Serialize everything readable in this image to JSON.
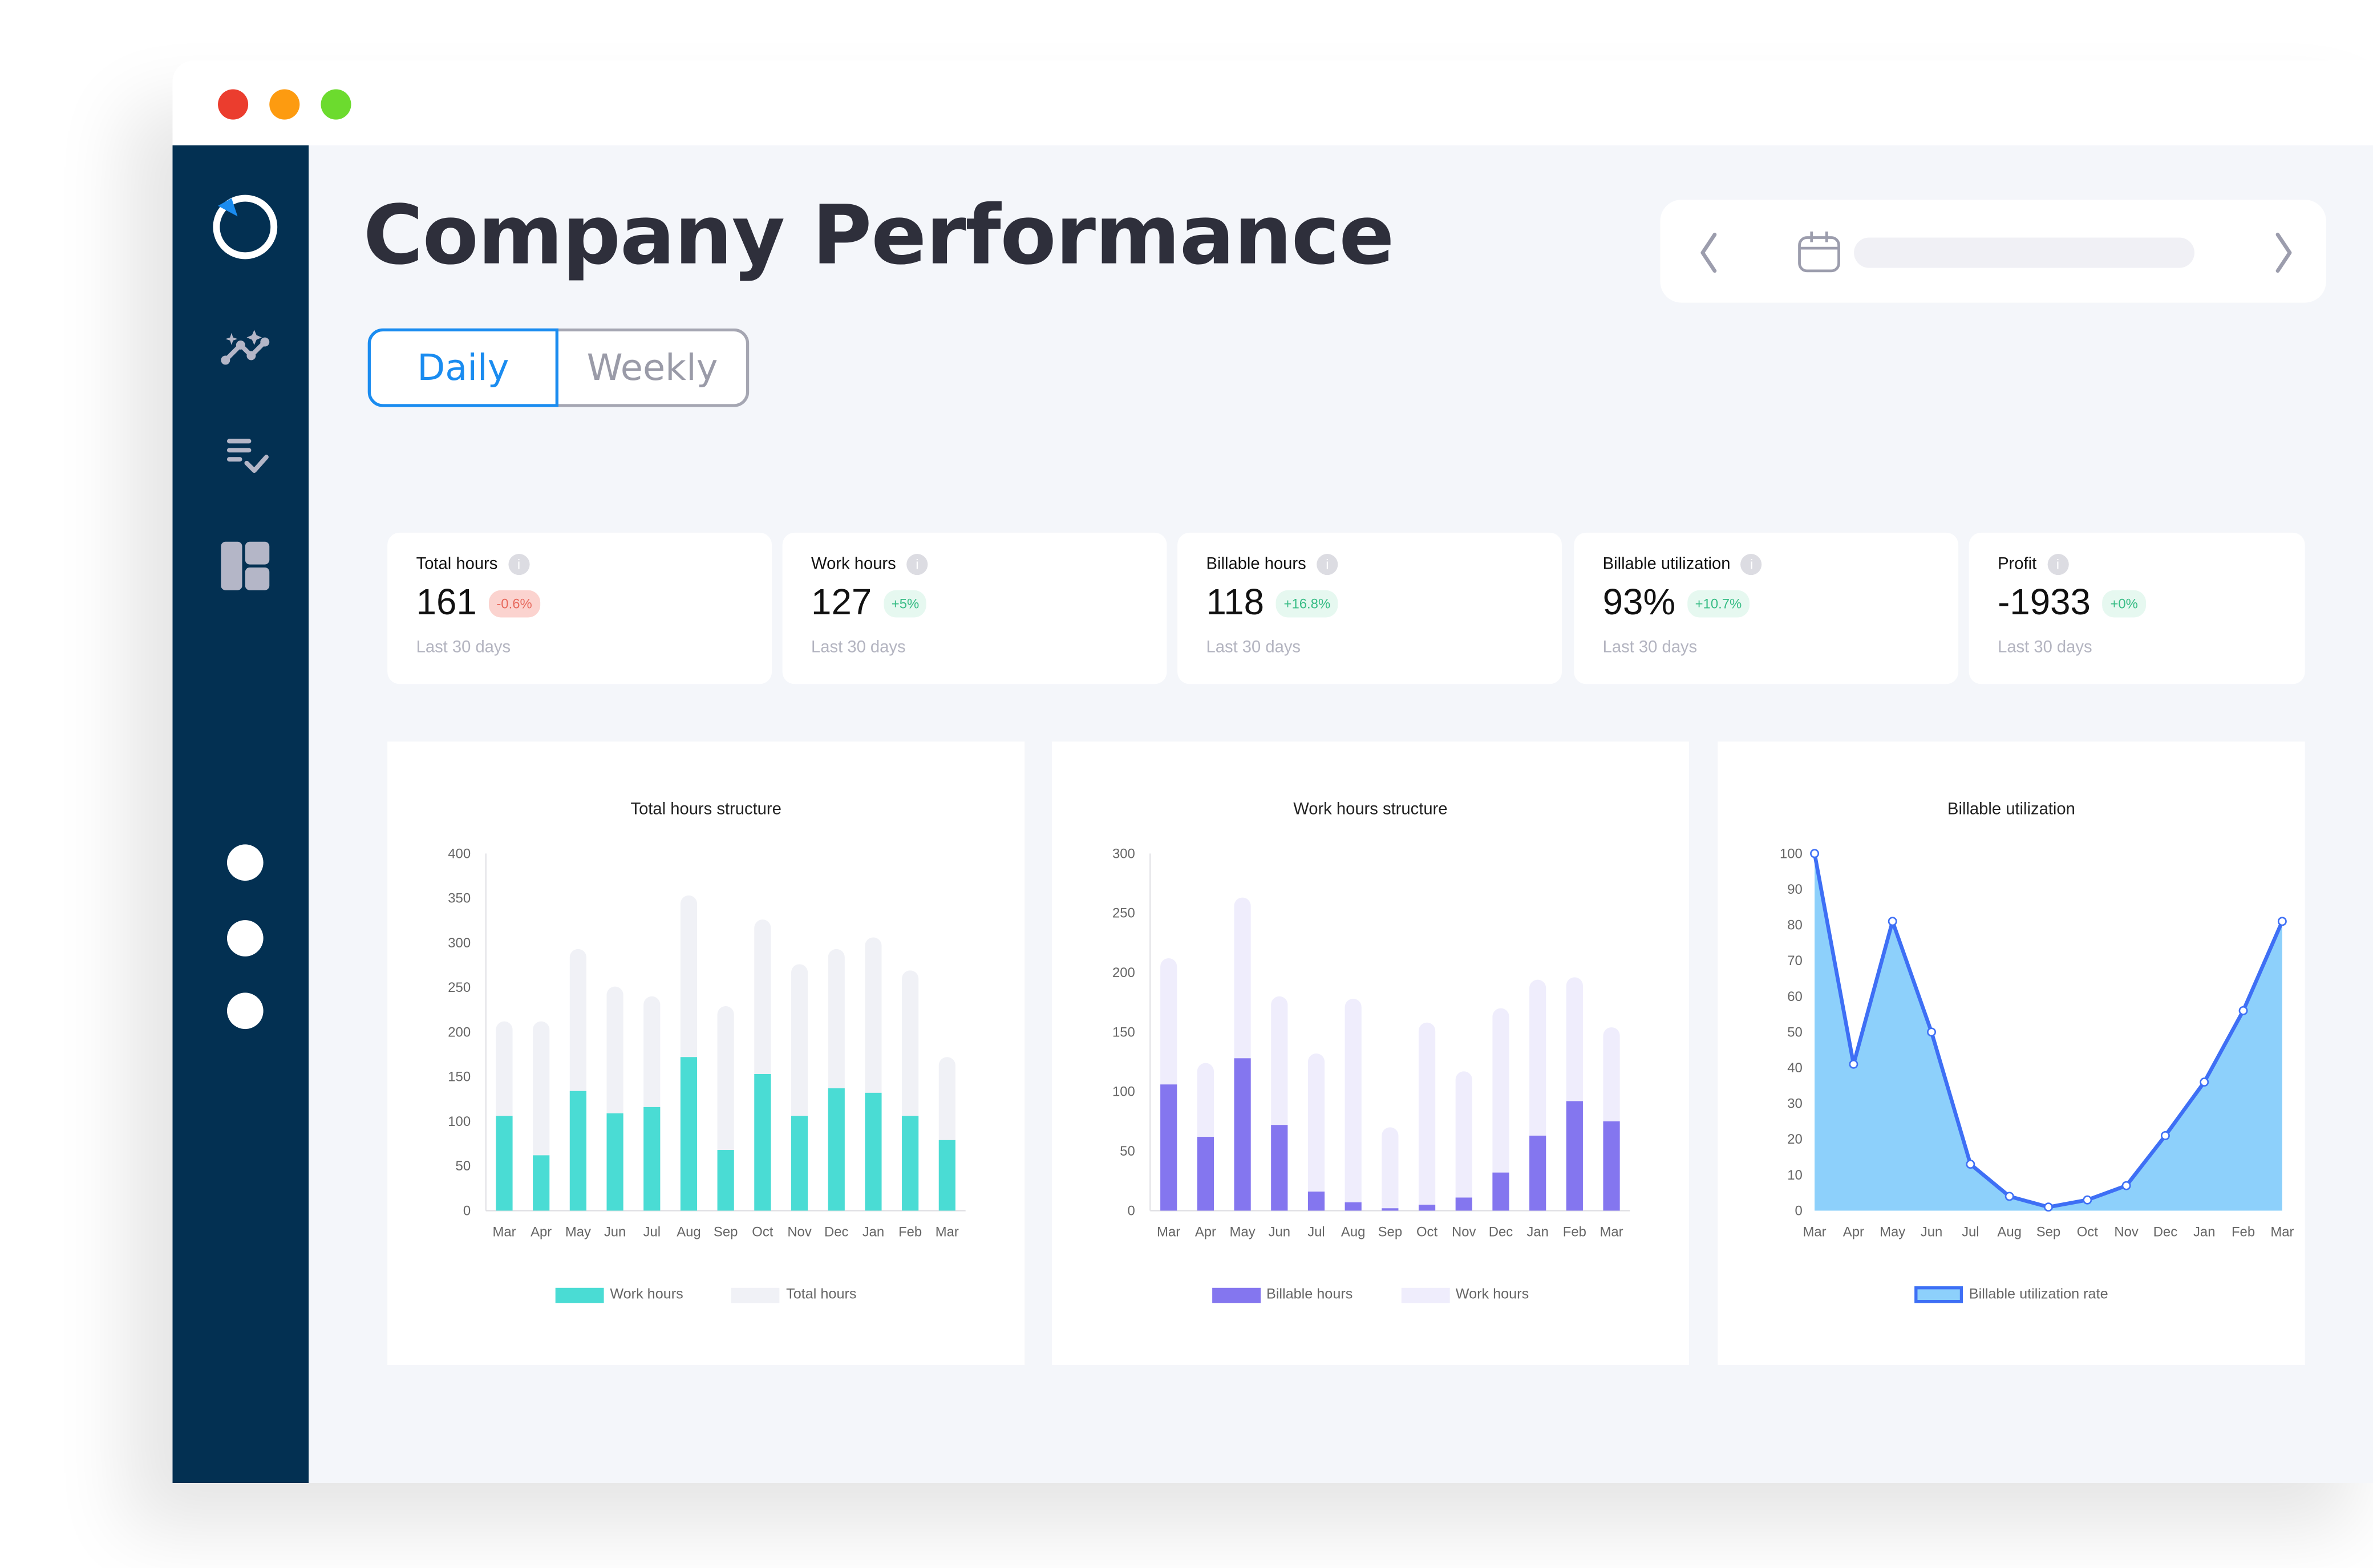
{
  "window": {
    "controls": [
      {
        "name": "close",
        "color": "#eb3d2e"
      },
      {
        "name": "minimize",
        "color": "#fd9b10"
      },
      {
        "name": "maximize",
        "color": "#6cdb2e"
      }
    ]
  },
  "sidebar": {
    "logo": "logo-icon",
    "items": [
      {
        "icon": "analytics-sparkle-icon",
        "label": "Analytics"
      },
      {
        "icon": "checklist-icon",
        "label": "Tasks"
      },
      {
        "icon": "dashboard-layout-icon",
        "label": "Dashboard"
      }
    ],
    "bottom_dots": 3
  },
  "header": {
    "title": "Company Performance",
    "toggle": {
      "options": [
        "Daily",
        "Weekly"
      ],
      "selected": "Daily"
    },
    "datepicker": {
      "prev_icon": "chevron-left-icon",
      "calendar_icon": "calendar-icon",
      "next_icon": "chevron-right-icon"
    }
  },
  "kpis": [
    {
      "label": "Total hours",
      "value": "161",
      "change": "-0.6%",
      "trend": "negative",
      "period": "Last 30 days"
    },
    {
      "label": "Work hours",
      "value": "127",
      "change": "+5%",
      "trend": "positive",
      "period": "Last 30 days"
    },
    {
      "label": "Billable hours",
      "value": "118",
      "change": "+16.8%",
      "trend": "positive",
      "period": "Last 30 days"
    },
    {
      "label": "Billable utilization",
      "value": "93%",
      "change": "+10.7%",
      "trend": "positive",
      "period": "Last 30 days"
    },
    {
      "label": "Profit",
      "value": "-1933",
      "change": "+0%",
      "trend": "positive",
      "period": "Last 30 days"
    }
  ],
  "colors": {
    "accent": "#1a8cf0",
    "sidebar": "#033052",
    "teal": "#4adcd4",
    "light_gray": "#f0f1f6",
    "purple": "#8476ef",
    "light_purple": "#efedfc",
    "line_blue": "#3e6ff5",
    "area_blue": "#8dd0fb"
  },
  "chart_data": [
    {
      "type": "bar",
      "title": "Total hours structure",
      "categories": [
        "Mar",
        "Apr",
        "May",
        "Jun",
        "Jul",
        "Aug",
        "Sep",
        "Oct",
        "Nov",
        "Dec",
        "Jan",
        "Feb",
        "Mar"
      ],
      "series": [
        {
          "name": "Work hours",
          "color": "#4adcd4",
          "values": [
            106,
            62,
            134,
            109,
            116,
            172,
            68,
            153,
            106,
            137,
            132,
            106,
            79
          ]
        },
        {
          "name": "Total hours",
          "color": "#f0f1f6",
          "values": [
            212,
            212,
            293,
            251,
            240,
            353,
            229,
            326,
            276,
            293,
            306,
            269,
            172
          ]
        }
      ],
      "yticks": [
        0,
        50,
        100,
        150,
        200,
        250,
        300,
        350,
        400
      ],
      "ylim": [
        0,
        400
      ],
      "xlabel": "",
      "ylabel": "",
      "legend": "bottom"
    },
    {
      "type": "bar",
      "title": "Work hours structure",
      "categories": [
        "Mar",
        "Apr",
        "May",
        "Jun",
        "Jul",
        "Aug",
        "Sep",
        "Oct",
        "Nov",
        "Dec",
        "Jan",
        "Feb",
        "Mar"
      ],
      "series": [
        {
          "name": "Billable hours",
          "color": "#8476ef",
          "values": [
            106,
            62,
            128,
            72,
            16,
            7,
            2,
            5,
            11,
            32,
            63,
            92,
            75
          ]
        },
        {
          "name": "Work hours",
          "color": "#efedfc",
          "values": [
            212,
            124,
            263,
            180,
            132,
            178,
            70,
            158,
            117,
            170,
            194,
            196,
            154
          ]
        }
      ],
      "yticks": [
        0,
        50,
        100,
        150,
        200,
        250,
        300
      ],
      "ylim": [
        0,
        300
      ],
      "xlabel": "",
      "ylabel": "",
      "legend": "bottom"
    },
    {
      "type": "area",
      "title": "Billable utilization",
      "categories": [
        "Mar",
        "Apr",
        "May",
        "Jun",
        "Jul",
        "Aug",
        "Sep",
        "Oct",
        "Nov",
        "Dec",
        "Jan",
        "Feb",
        "Mar"
      ],
      "series": [
        {
          "name": "Billable utilization rate",
          "color": "#3e6ff5",
          "fill": "#8dd0fb",
          "values": [
            100,
            41,
            81,
            50,
            13,
            4,
            1,
            3,
            7,
            21,
            36,
            56,
            81
          ]
        }
      ],
      "yticks": [
        0,
        10,
        20,
        30,
        40,
        50,
        60,
        70,
        80,
        90,
        100
      ],
      "ylim": [
        0,
        100
      ],
      "xlabel": "",
      "ylabel": "",
      "legend": "bottom"
    }
  ]
}
